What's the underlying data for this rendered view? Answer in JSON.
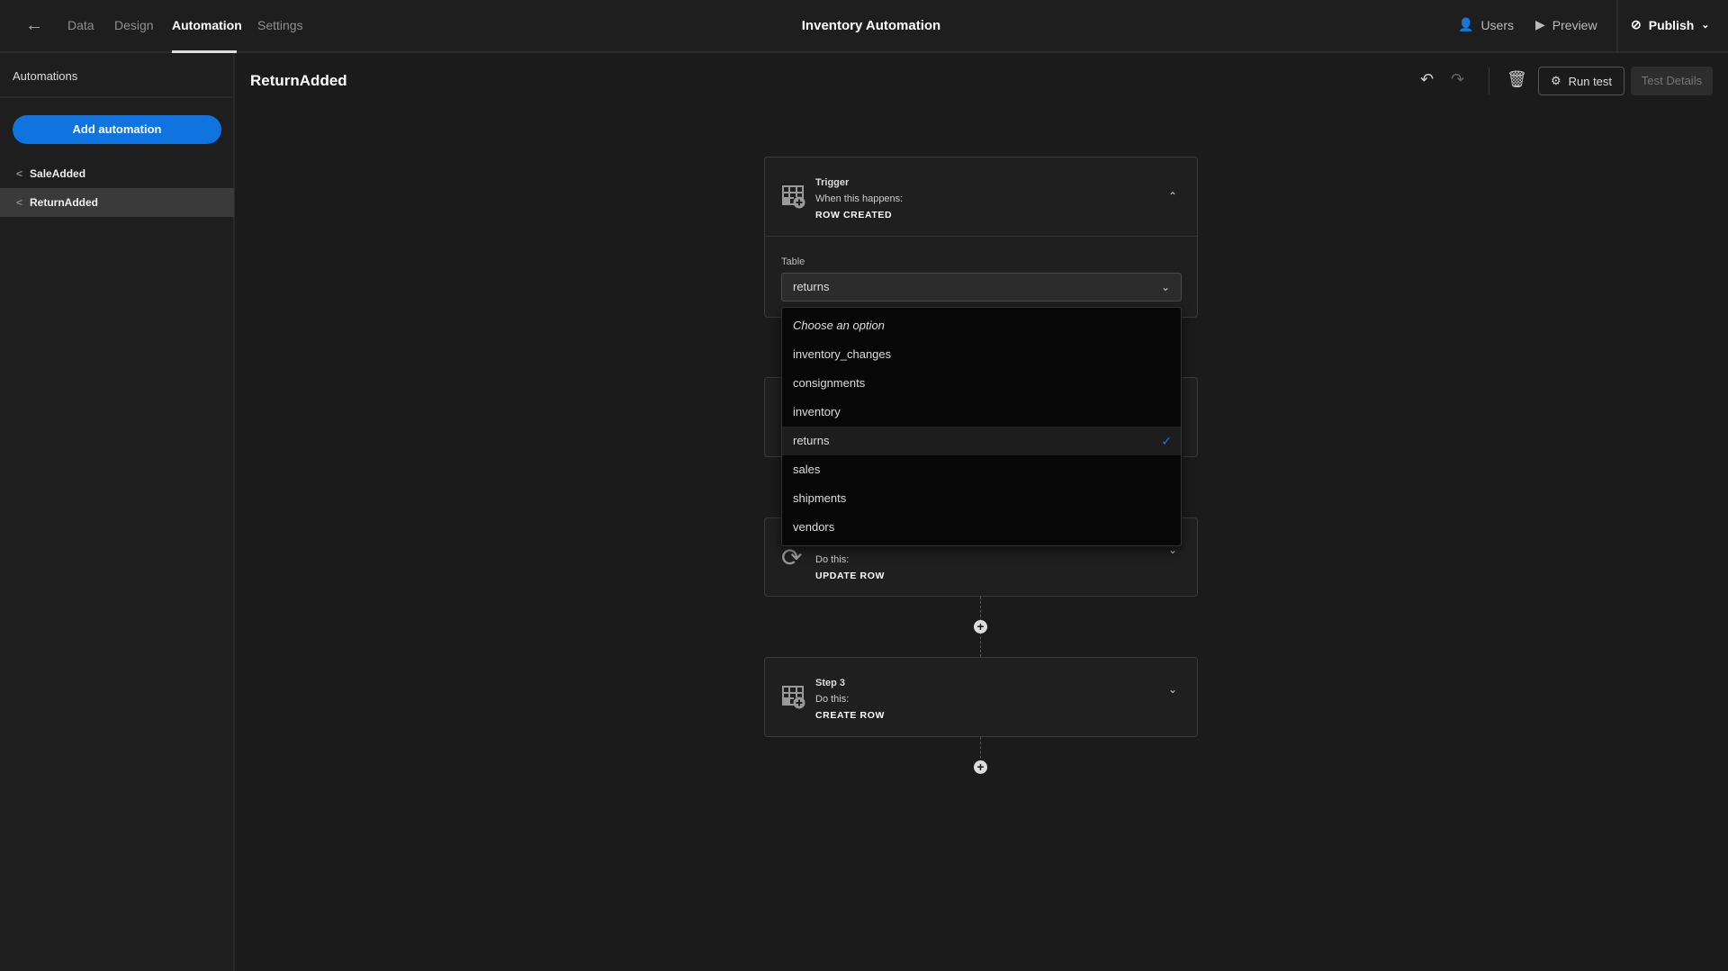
{
  "nav": {
    "tabs": [
      {
        "label": "Data"
      },
      {
        "label": "Design"
      },
      {
        "label": "Automation",
        "active": true
      },
      {
        "label": "Settings"
      }
    ],
    "title": "Inventory Automation",
    "users": "Users",
    "preview": "Preview",
    "publish": "Publish"
  },
  "sidebar": {
    "title": "Automations",
    "add_button": "Add automation",
    "items": [
      {
        "label": "SaleAdded"
      },
      {
        "label": "ReturnAdded",
        "selected": true
      }
    ]
  },
  "main": {
    "title": "ReturnAdded",
    "run_test": "Run test",
    "test_details": "Test Details"
  },
  "trigger": {
    "title": "Trigger",
    "subtitle": "When this happens:",
    "event": "ROW CREATED",
    "table_label": "Table",
    "table_value": "returns"
  },
  "dropdown": {
    "placeholder": "Choose an option",
    "options": [
      "inventory_changes",
      "consignments",
      "inventory",
      "returns",
      "sales",
      "shipments",
      "vendors"
    ],
    "selected": "returns"
  },
  "step2": {
    "subtitle": "Do this:",
    "action": "UPDATE ROW"
  },
  "step3": {
    "title": "Step 3",
    "subtitle": "Do this:",
    "action": "CREATE ROW"
  },
  "colors": {
    "accent": "#0f73e0",
    "check": "#1a73e8"
  }
}
